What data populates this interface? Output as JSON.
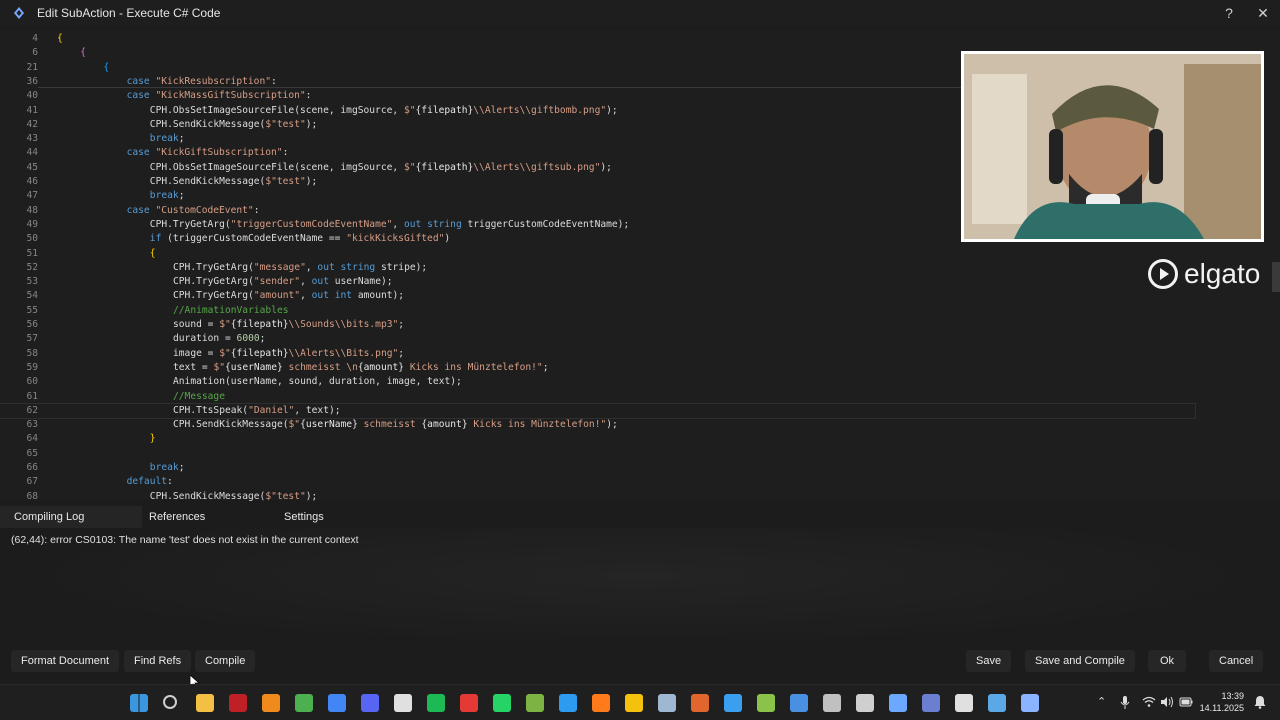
{
  "window": {
    "title": "Edit SubAction - Execute C# Code",
    "help_glyph": "?",
    "close_glyph": "✕"
  },
  "editor": {
    "lines": [
      {
        "n": "4",
        "segs": [
          {
            "c": "br1",
            "t": "{"
          }
        ],
        "indent": 0
      },
      {
        "n": "6",
        "segs": [
          {
            "c": "br2",
            "t": "{"
          }
        ],
        "indent": 1
      },
      {
        "n": "21",
        "segs": [
          {
            "c": "br3",
            "t": "{"
          }
        ],
        "indent": 2
      },
      {
        "n": "36",
        "segs": [
          {
            "c": "kw",
            "t": "case "
          },
          {
            "c": "str",
            "t": "\"KickResubscription\""
          },
          {
            "c": "",
            "t": ":"
          }
        ],
        "indent": 3
      },
      {
        "n": "40",
        "segs": [
          {
            "c": "kw",
            "t": "case "
          },
          {
            "c": "str",
            "t": "\"KickMassGiftSubscription\""
          },
          {
            "c": "",
            "t": ":"
          }
        ],
        "indent": 3
      },
      {
        "n": "41",
        "segs": [
          {
            "c": "",
            "t": "CPH.ObsSetImageSourceFile(scene, imgSource, "
          },
          {
            "c": "str",
            "t": "$\""
          },
          {
            "c": "interp",
            "t": "{filepath}"
          },
          {
            "c": "str",
            "t": "\\\\Alerts\\\\giftbomb.png\""
          },
          {
            "c": "",
            "t": ");"
          }
        ],
        "indent": 4
      },
      {
        "n": "42",
        "segs": [
          {
            "c": "",
            "t": "CPH.SendKickMessage("
          },
          {
            "c": "str",
            "t": "$\"test\""
          },
          {
            "c": "",
            "t": ");"
          }
        ],
        "indent": 4
      },
      {
        "n": "43",
        "segs": [
          {
            "c": "kw",
            "t": "break"
          },
          {
            "c": "",
            "t": ";"
          }
        ],
        "indent": 4
      },
      {
        "n": "44",
        "segs": [
          {
            "c": "kw",
            "t": "case "
          },
          {
            "c": "str",
            "t": "\"KickGiftSubscription\""
          },
          {
            "c": "",
            "t": ":"
          }
        ],
        "indent": 3
      },
      {
        "n": "45",
        "segs": [
          {
            "c": "",
            "t": "CPH.ObsSetImageSourceFile(scene, imgSource, "
          },
          {
            "c": "str",
            "t": "$\""
          },
          {
            "c": "interp",
            "t": "{filepath}"
          },
          {
            "c": "str",
            "t": "\\\\Alerts\\\\giftsub.png\""
          },
          {
            "c": "",
            "t": ");"
          }
        ],
        "indent": 4
      },
      {
        "n": "46",
        "segs": [
          {
            "c": "",
            "t": "CPH.SendKickMessage("
          },
          {
            "c": "str",
            "t": "$\"test\""
          },
          {
            "c": "",
            "t": ");"
          }
        ],
        "indent": 4
      },
      {
        "n": "47",
        "segs": [
          {
            "c": "kw",
            "t": "break"
          },
          {
            "c": "",
            "t": ";"
          }
        ],
        "indent": 4
      },
      {
        "n": "48",
        "segs": [
          {
            "c": "kw",
            "t": "case "
          },
          {
            "c": "str",
            "t": "\"CustomCodeEvent\""
          },
          {
            "c": "",
            "t": ":"
          }
        ],
        "indent": 3
      },
      {
        "n": "49",
        "segs": [
          {
            "c": "",
            "t": "CPH.TryGetArg("
          },
          {
            "c": "str",
            "t": "\"triggerCustomCodeEventName\""
          },
          {
            "c": "",
            "t": ", "
          },
          {
            "c": "kw",
            "t": "out string"
          },
          {
            "c": "",
            "t": " triggerCustomCodeEventName);"
          }
        ],
        "indent": 4
      },
      {
        "n": "50",
        "segs": [
          {
            "c": "kw",
            "t": "if "
          },
          {
            "c": "",
            "t": "(triggerCustomCodeEventName == "
          },
          {
            "c": "str",
            "t": "\"kickKicksGifted\""
          },
          {
            "c": "",
            "t": ")"
          }
        ],
        "indent": 4
      },
      {
        "n": "51",
        "segs": [
          {
            "c": "br1",
            "t": "{"
          }
        ],
        "indent": 4
      },
      {
        "n": "52",
        "segs": [
          {
            "c": "",
            "t": "CPH.TryGetArg("
          },
          {
            "c": "str",
            "t": "\"message\""
          },
          {
            "c": "",
            "t": ", "
          },
          {
            "c": "kw",
            "t": "out string"
          },
          {
            "c": "",
            "t": " stripe);"
          }
        ],
        "indent": 5
      },
      {
        "n": "53",
        "segs": [
          {
            "c": "",
            "t": "CPH.TryGetArg("
          },
          {
            "c": "str",
            "t": "\"sender\""
          },
          {
            "c": "",
            "t": ", "
          },
          {
            "c": "kw",
            "t": "out"
          },
          {
            "c": "",
            "t": " userName);"
          }
        ],
        "indent": 5
      },
      {
        "n": "54",
        "segs": [
          {
            "c": "",
            "t": "CPH.TryGetArg("
          },
          {
            "c": "str",
            "t": "\"amount\""
          },
          {
            "c": "",
            "t": ", "
          },
          {
            "c": "kw",
            "t": "out int"
          },
          {
            "c": "",
            "t": " amount);"
          }
        ],
        "indent": 5
      },
      {
        "n": "55",
        "segs": [
          {
            "c": "cmt",
            "t": "//AnimationVariables"
          }
        ],
        "indent": 5
      },
      {
        "n": "56",
        "segs": [
          {
            "c": "",
            "t": "sound = "
          },
          {
            "c": "str",
            "t": "$\""
          },
          {
            "c": "interp",
            "t": "{filepath}"
          },
          {
            "c": "str",
            "t": "\\\\Sounds\\\\bits.mp3\""
          },
          {
            "c": "",
            "t": ";"
          }
        ],
        "indent": 5
      },
      {
        "n": "57",
        "segs": [
          {
            "c": "",
            "t": "duration = "
          },
          {
            "c": "num",
            "t": "6000"
          },
          {
            "c": "",
            "t": ";"
          }
        ],
        "indent": 5
      },
      {
        "n": "58",
        "segs": [
          {
            "c": "",
            "t": "image = "
          },
          {
            "c": "str",
            "t": "$\""
          },
          {
            "c": "interp",
            "t": "{filepath}"
          },
          {
            "c": "str",
            "t": "\\\\Alerts\\\\Bits.png\""
          },
          {
            "c": "",
            "t": ";"
          }
        ],
        "indent": 5
      },
      {
        "n": "59",
        "segs": [
          {
            "c": "",
            "t": "text = "
          },
          {
            "c": "str",
            "t": "$\""
          },
          {
            "c": "interp",
            "t": "{userName}"
          },
          {
            "c": "str",
            "t": " schmeisst \\n"
          },
          {
            "c": "interp",
            "t": "{amount}"
          },
          {
            "c": "str",
            "t": " Kicks ins Münztelefon!\""
          },
          {
            "c": "",
            "t": ";"
          }
        ],
        "indent": 5
      },
      {
        "n": "60",
        "segs": [
          {
            "c": "",
            "t": "Animation(userName, sound, duration, image, text);"
          }
        ],
        "indent": 5
      },
      {
        "n": "61",
        "segs": [
          {
            "c": "cmt",
            "t": "//Message"
          }
        ],
        "indent": 5
      },
      {
        "n": "62",
        "segs": [
          {
            "c": "",
            "t": "CPH.TtsSpeak("
          },
          {
            "c": "str",
            "t": "\"Daniel\""
          },
          {
            "c": "",
            "t": ", text);"
          }
        ],
        "indent": 5,
        "current": true
      },
      {
        "n": "63",
        "segs": [
          {
            "c": "",
            "t": "CPH.SendKickMessage("
          },
          {
            "c": "str",
            "t": "$\""
          },
          {
            "c": "interp",
            "t": "{userName}"
          },
          {
            "c": "str",
            "t": " schmeisst "
          },
          {
            "c": "interp",
            "t": "{amount}"
          },
          {
            "c": "str",
            "t": " Kicks ins Münztelefon!\""
          },
          {
            "c": "",
            "t": ");"
          }
        ],
        "indent": 5
      },
      {
        "n": "64",
        "segs": [
          {
            "c": "br1",
            "t": "}"
          }
        ],
        "indent": 4
      },
      {
        "n": "65",
        "segs": [],
        "indent": 0
      },
      {
        "n": "66",
        "segs": [
          {
            "c": "kw",
            "t": "break"
          },
          {
            "c": "",
            "t": ";"
          }
        ],
        "indent": 4
      },
      {
        "n": "67",
        "segs": [
          {
            "c": "kw",
            "t": "default"
          },
          {
            "c": "",
            "t": ":"
          }
        ],
        "indent": 3
      },
      {
        "n": "68",
        "segs": [
          {
            "c": "",
            "t": "CPH.SendKickMessage("
          },
          {
            "c": "str",
            "t": "$\"test\""
          },
          {
            "c": "",
            "t": ");"
          }
        ],
        "indent": 4
      }
    ]
  },
  "webcam": {
    "brand": "elgato"
  },
  "panel": {
    "tabs": [
      "Compiling Log",
      "References",
      "Settings"
    ],
    "log_message": "(62,44): error CS0103: The name 'test' does not exist in the current context"
  },
  "buttons": {
    "format_document": "Format Document",
    "find_refs": "Find Refs",
    "compile": "Compile",
    "save": "Save",
    "save_and_compile": "Save and Compile",
    "ok": "Ok",
    "cancel": "Cancel"
  },
  "taskbar": {
    "time": "13:39",
    "date": "14.11.2025",
    "apps": [
      {
        "name": "windows-start-icon",
        "color": "#3a96dd"
      },
      {
        "name": "search-icon",
        "color": "#cfcfcf"
      },
      {
        "name": "file-explorer-icon",
        "color": "#f3c043"
      },
      {
        "name": "filezilla-icon",
        "color": "#bf2026"
      },
      {
        "name": "vlc-icon",
        "color": "#f08a1c"
      },
      {
        "name": "chrome-icon",
        "color": "#4caf50"
      },
      {
        "name": "chrome-profile-icon",
        "color": "#4285f4"
      },
      {
        "name": "discord-icon",
        "color": "#5865f2"
      },
      {
        "name": "epic-games-icon",
        "color": "#e0e0e0"
      },
      {
        "name": "spotify-icon",
        "color": "#1db954"
      },
      {
        "name": "git-icon",
        "color": "#e53935"
      },
      {
        "name": "whatsapp-icon",
        "color": "#25d366"
      },
      {
        "name": "notepad-plus-icon",
        "color": "#7cb342"
      },
      {
        "name": "vscode-icon",
        "color": "#2d9cf0"
      },
      {
        "name": "app-a-icon",
        "color": "#ff7a1a"
      },
      {
        "name": "app-p-icon",
        "color": "#f4c20d"
      },
      {
        "name": "steam-icon",
        "color": "#9fb7d1"
      },
      {
        "name": "app-x-icon",
        "color": "#e0662e"
      },
      {
        "name": "app-blue-icon",
        "color": "#3b9ff0"
      },
      {
        "name": "cube-icon",
        "color": "#8bc34a"
      },
      {
        "name": "app-round-icon",
        "color": "#4a90e2"
      },
      {
        "name": "streamdeck-icon",
        "color": "#c0c0c0"
      },
      {
        "name": "obs-icon",
        "color": "#cfcfcf"
      },
      {
        "name": "streamerbot-icon",
        "color": "#6aa9ff"
      },
      {
        "name": "app-dark-icon",
        "color": "#6a7fd0"
      },
      {
        "name": "app-circle-icon",
        "color": "#e0e0e0"
      },
      {
        "name": "notepad-icon",
        "color": "#5aa9e6"
      },
      {
        "name": "audio-icon",
        "color": "#8ab4ff"
      }
    ]
  }
}
